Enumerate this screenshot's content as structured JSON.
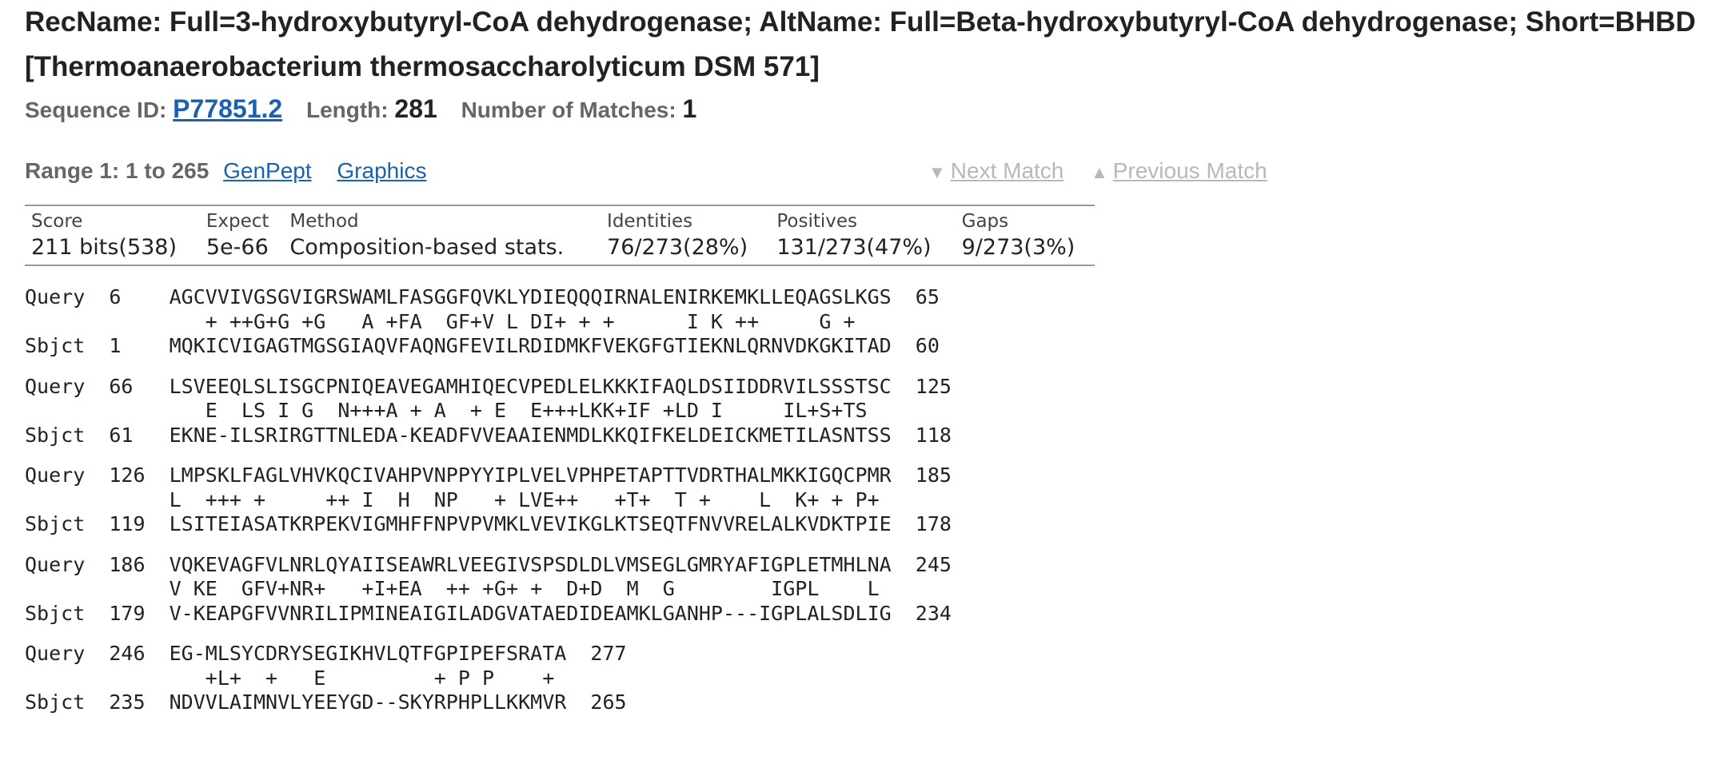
{
  "header": {
    "title_line1": "RecName: Full=3-hydroxybutyryl-CoA dehydrogenase; AltName: Full=Beta-hydroxybutyryl-CoA dehydrogenase; Short=BHBD",
    "title_line2": "[Thermoanaerobacterium thermosaccharolyticum DSM 571]"
  },
  "meta": {
    "seq_id_label": "Sequence ID:",
    "seq_id": "P77851.2",
    "length_label": "Length:",
    "length": "281",
    "matches_label": "Number of Matches:",
    "matches": "1"
  },
  "range": {
    "title": "Range 1: 1 to 265",
    "genpept": "GenPept",
    "graphics": "Graphics",
    "next_match": "Next Match",
    "previous_match": "Previous Match"
  },
  "stats": {
    "headers": [
      "Score",
      "Expect",
      "Method",
      "Identities",
      "Positives",
      "Gaps"
    ],
    "values": [
      "211 bits(538)",
      "5e-66",
      "Composition-based stats.",
      "76/273(28%)",
      "131/273(47%)",
      "9/273(3%)"
    ]
  },
  "alignment": [
    {
      "query": "Query  6    AGCVVIVGSGVIGRSWAMLFASGGFQVKLYDIEQQQIRNALENIRKEMKLLEQAGSLKGS  65",
      "mid": "               + ++G+G +G   A +FA  GF+V L DI+ + +      I K ++     G +",
      "sbjct": "Sbjct  1    MQKICVIGAGTMGSGIAQVFAQNGFEVILRDIDMKFVEKGFGTIEKNLQRNVDKGKITAD  60"
    },
    {
      "query": "Query  66   LSVEEQLSLISGCPNIQEAVEGAMHIQECVPEDLELKKKIFAQLDSIIDDRVILSSSTSC  125",
      "mid": "               E  LS I G  N+++A + A  + E  E+++LKK+IF +LD I     IL+S+TS",
      "sbjct": "Sbjct  61   EKNE-ILSRIRGTTNLEDA-KEADFVVEAAIENMDLKKQIFKELDEICKMETILASNTSS  118"
    },
    {
      "query": "Query  126  LMPSKLFAGLVHVKQCIVAHPVNPPYYIPLVELVPHPETAPTTVDRTHALMKKIGQCPMR  185",
      "mid": "            L  +++ +     ++ I  H  NP   + LVE++   +T+  T +    L  K+ + P+",
      "sbjct": "Sbjct  119  LSITEIASATKRPEKVIGMHFFNPVPVMKLVEVIKGLKTSEQTFNVVRELALKVDKTPIE  178"
    },
    {
      "query": "Query  186  VQKEVAGFVLNRLQYAIISEAWRLVEEGIVSPSDLDLVMSEGLGMRYAFIGPLETMHLNA  245",
      "mid": "            V KE  GFV+NR+   +I+EA  ++ +G+ +  D+D  M  G        IGPL    L",
      "sbjct": "Sbjct  179  V-KEAPGFVVNRILIPMINEAIGILADGVATAEDIDEAMKLGANHP---IGPLALSDLIG  234"
    },
    {
      "query": "Query  246  EG-MLSYCDRYSEGIKHVLQTFGPIPEFSRATA  277",
      "mid": "               +L+  +   E         + P P    +",
      "sbjct": "Sbjct  235  NDVVLAIMNVLYEEYGD--SKYRPHPLLKKMVR  265"
    }
  ],
  "colors": {
    "link": "#1a62b0",
    "disabled": "#b4b9be",
    "label": "#666666"
  }
}
